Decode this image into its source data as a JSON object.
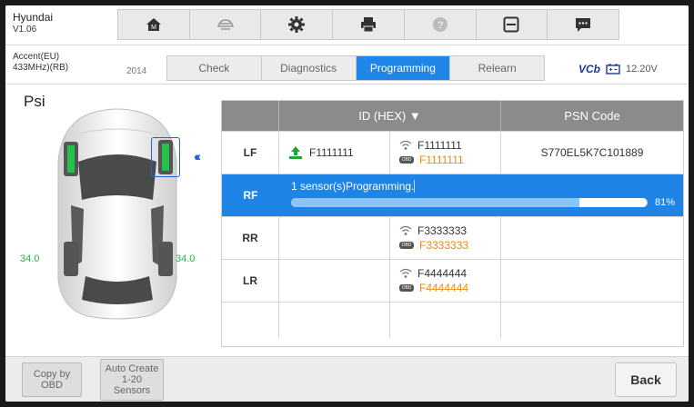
{
  "header": {
    "app_title": "Hyundai",
    "version": "V1.06",
    "toolbar_icons": [
      "home-icon",
      "vehicle-switch-icon",
      "settings-icon",
      "print-icon",
      "help-icon",
      "save-icon",
      "message-icon"
    ]
  },
  "subbar": {
    "model_line1": "Accent(EU)",
    "model_line2": "433MHz)(RB)",
    "year": "2014",
    "tabs": [
      {
        "label": "Check",
        "active": false
      },
      {
        "label": "Diagnostics",
        "active": false
      },
      {
        "label": "Programming",
        "active": true
      },
      {
        "label": "Relearn",
        "active": false
      }
    ],
    "vci_label": "VCb",
    "battery": "12.20V"
  },
  "main": {
    "unit": "Psi",
    "tires": {
      "lf_psi": "",
      "rf_psi": "",
      "lr_psi": "34.0",
      "rr_psi": "34.0"
    },
    "table": {
      "headers": [
        "",
        "ID (HEX) ▼",
        "",
        "PSN Code"
      ],
      "rows": {
        "lf": {
          "pos": "LF",
          "programmed_id": "F1111111",
          "sensor_id": "F1111111",
          "obd_id": "F1111111",
          "psn": "S770EL5K7C101889"
        },
        "rf": {
          "pos": "RF",
          "status": "1 sensor(s)Programming.",
          "progress_pct": 81,
          "progress_label": "81%"
        },
        "rr": {
          "pos": "RR",
          "sensor_id": "F3333333",
          "obd_id": "F3333333"
        },
        "lr": {
          "pos": "LR",
          "sensor_id": "F4444444",
          "obd_id": "F4444444"
        }
      }
    }
  },
  "bottom": {
    "copy_obd_line1": "Copy by",
    "copy_obd_line2": "OBD",
    "auto_create_line1": "Auto Create",
    "auto_create_line2": "1-20",
    "auto_create_line3": "Sensors",
    "back_label": "Back"
  }
}
